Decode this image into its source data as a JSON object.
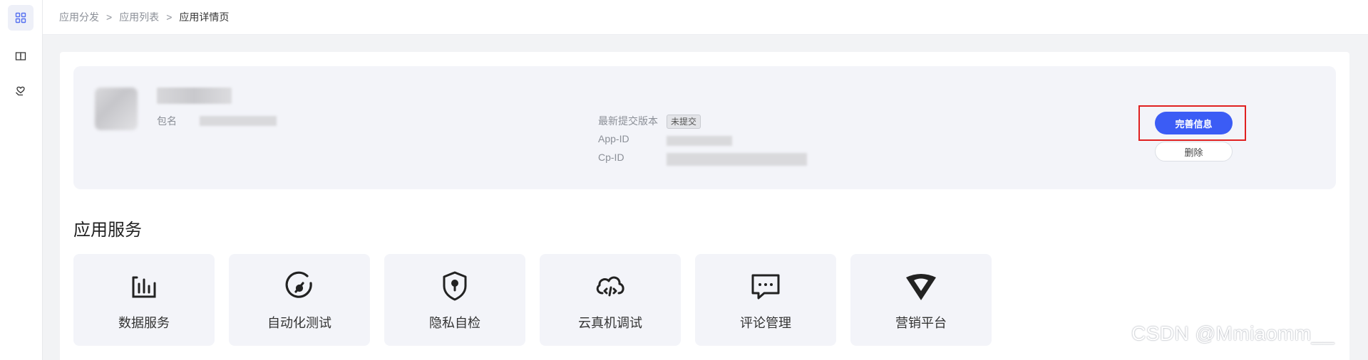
{
  "rail": {
    "items": [
      {
        "icon": "grid-icon",
        "active": true
      },
      {
        "icon": "book-icon",
        "active": false
      },
      {
        "icon": "heart-hand-icon",
        "active": false
      }
    ]
  },
  "breadcrumb": {
    "items": [
      "应用分发",
      "应用列表",
      "应用详情页"
    ],
    "separator": ">"
  },
  "app_info": {
    "package_label": "包名",
    "latest_version_label": "最新提交版本",
    "latest_version_status": "未提交",
    "app_id_label": "App-ID",
    "cp_id_label": "Cp-ID"
  },
  "actions": {
    "complete_info_label": "完善信息",
    "delete_label": "删除",
    "primary_color": "#3b5cf5",
    "highlight_color": "#e02020"
  },
  "services": {
    "title": "应用服务",
    "items": [
      {
        "label": "数据服务",
        "icon": "bar-chart-icon"
      },
      {
        "label": "自动化测试",
        "icon": "gauge-icon"
      },
      {
        "label": "隐私自检",
        "icon": "shield-lock-icon"
      },
      {
        "label": "云真机调试",
        "icon": "cloud-code-icon"
      },
      {
        "label": "评论管理",
        "icon": "comment-icon"
      },
      {
        "label": "营销平台",
        "icon": "marketing-v-icon"
      }
    ]
  },
  "watermark": "CSDN @Mmiaomm__"
}
